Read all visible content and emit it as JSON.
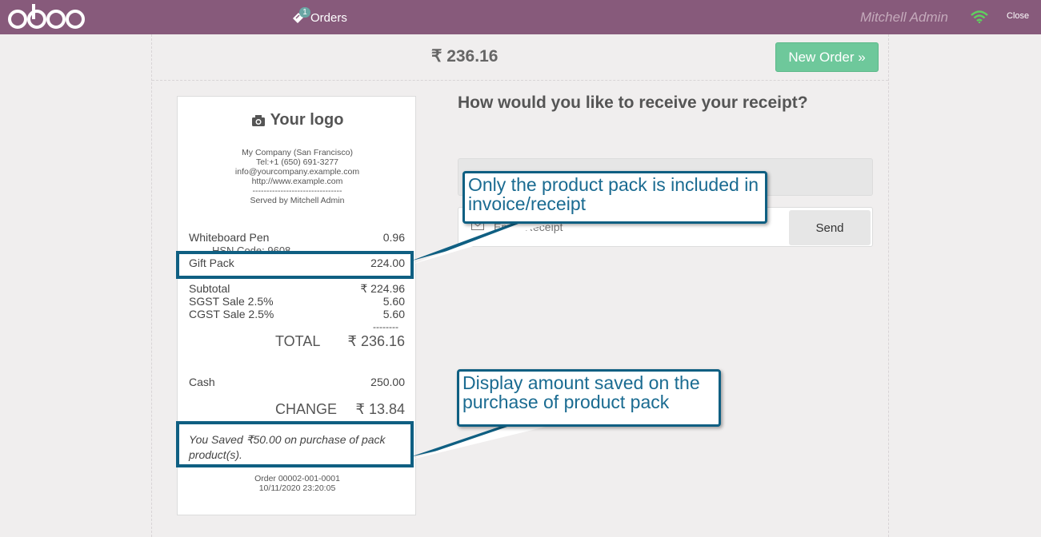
{
  "header": {
    "logo_text": "odoo",
    "orders_label": "Orders",
    "orders_badge": "1",
    "user_name": "Mitchell Admin",
    "close_label": "Close"
  },
  "toolbar": {
    "amount": "₹ 236.16",
    "new_order_label": "New Order »"
  },
  "receipt": {
    "logo_text": "Your logo",
    "company_lines": [
      "My Company (San Francisco)",
      "Tel:+1 (650) 691-3277",
      "info@yourcompany.example.com",
      "http://www.example.com",
      "--------------------------------",
      "Served by Mitchell Admin"
    ],
    "lines": [
      {
        "name": "Whiteboard Pen",
        "price": "0.96"
      },
      {
        "name": "Gift Pack",
        "price": "224.00"
      }
    ],
    "hsn_code": "HSN Code: 9608",
    "subtotal_label": "Subtotal",
    "subtotal_value": "₹ 224.96",
    "taxes": [
      {
        "name": "SGST Sale 2.5%",
        "value": "5.60"
      },
      {
        "name": "CGST Sale 2.5%",
        "value": "5.60"
      }
    ],
    "dashes": "--------",
    "total_label": "TOTAL",
    "total_value": "₹ 236.16",
    "payment_label": "Cash",
    "payment_value": "250.00",
    "change_label": "CHANGE",
    "change_value": "₹ 13.84",
    "saved_text": "You Saved ₹50.00 on purchase of pack product(s).",
    "order_ref": "Order 00002-001-0001",
    "order_date": "10/11/2020 23:20:05"
  },
  "receipt_options": {
    "question": "How would you like to receive your receipt?",
    "email_placeholder": "Email Receipt",
    "send_label": "Send"
  },
  "annotations": {
    "pack_note": "Only the product pack is included in invoice/receipt",
    "saved_note": "Display amount saved on the purchase of product pack"
  },
  "colors": {
    "header_bg": "#875a7b",
    "new_order_bg": "#6ec89b",
    "annotation": "#0f5f82"
  }
}
